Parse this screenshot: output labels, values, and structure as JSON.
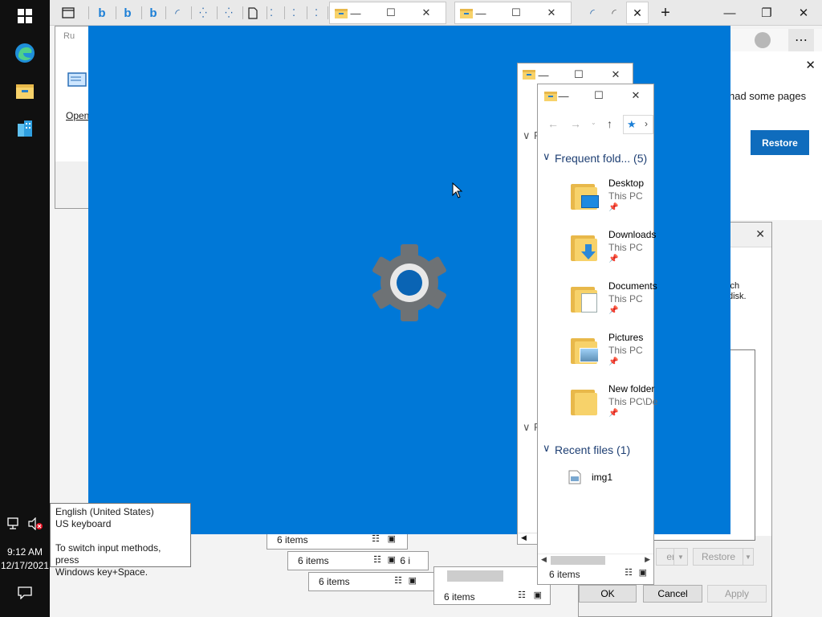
{
  "taskbar": {
    "time": "9:12 AM",
    "date": "12/17/2021"
  },
  "tooltip": {
    "line1": "English (United States)",
    "line2": "US keyboard",
    "line3": "To switch input methods, press",
    "line4": "Windows key+Space."
  },
  "run_dialog": {
    "title": "Ru",
    "open_label": "Open"
  },
  "edge_panel": {
    "message": "had some pages",
    "restore_label": "Restore"
  },
  "props_dialog": {
    "text1": "ich",
    "text2": "disk.",
    "ok_label": "OK",
    "cancel_label": "Cancel",
    "apply_label": "Apply",
    "restore_label": "Restore",
    "open_label": "en"
  },
  "explorer": {
    "title": "",
    "frequent_label": "Frequent fold... (5)",
    "recent_label": "Recent files (1)",
    "status": "6 items",
    "items": [
      {
        "name": "Desktop",
        "sub": "This PC"
      },
      {
        "name": "Downloads",
        "sub": "This PC"
      },
      {
        "name": "Documents",
        "sub": "This PC"
      },
      {
        "name": "Pictures",
        "sub": "This PC"
      },
      {
        "name": "New folder",
        "sub": "This PC\\De"
      }
    ],
    "recent_file": "img1"
  },
  "explorer_back": {
    "letter1": "F",
    "letter2": "F"
  },
  "stacked_status": {
    "s1": "6 items",
    "s2": "6 items",
    "s3": "6 items",
    "s4": "6 items",
    "frag": "6 i"
  },
  "colors": {
    "splash": "#0078d7",
    "accent": "#0078d7",
    "folder": "#f7d26a"
  }
}
